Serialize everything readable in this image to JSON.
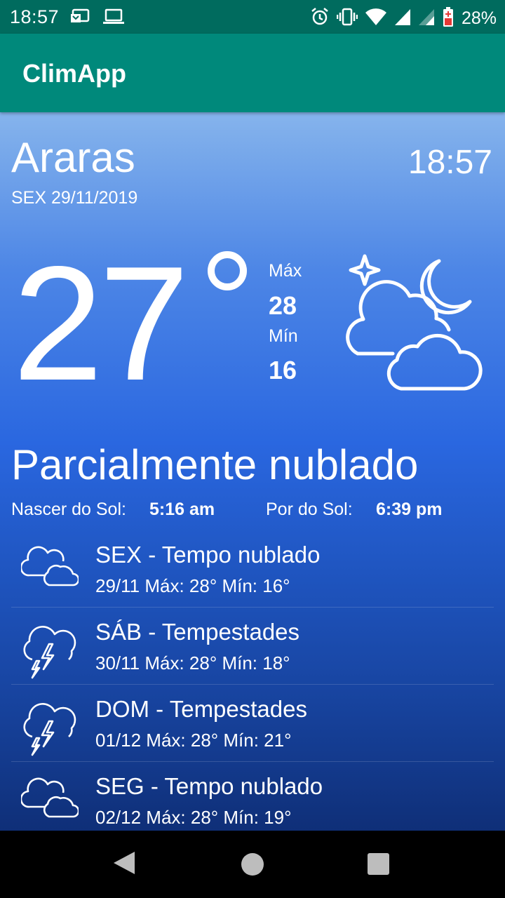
{
  "status_bar": {
    "time": "18:57",
    "battery_percent": "28%",
    "left_icons": [
      "notification-card-icon",
      "laptop-icon"
    ],
    "right_icons": [
      "alarm-icon",
      "vibrate-icon",
      "wifi-icon",
      "signal-icon",
      "signal-weak-icon",
      "battery-icon"
    ]
  },
  "app_bar": {
    "title": "ClimApp"
  },
  "current": {
    "city": "Araras",
    "time": "18:57",
    "date": "SEX 29/11/2019",
    "temperature": "27",
    "max_label": "Máx",
    "max_value": "28",
    "min_label": "Mín",
    "min_value": "16",
    "icon": "partly-cloudy-night-icon",
    "condition": "Parcialmente nublado",
    "sunrise_label": "Nascer do Sol:",
    "sunrise_value": "5:16 am",
    "sunset_label": "Por do Sol:",
    "sunset_value": "6:39 pm"
  },
  "forecast": [
    {
      "title": "SEX - Tempo nublado",
      "detail": "29/11 Máx: 28° Mín: 16°",
      "icon": "cloudy-icon"
    },
    {
      "title": "SÁB - Tempestades",
      "detail": "30/11 Máx: 28° Mín: 18°",
      "icon": "thunderstorm-icon"
    },
    {
      "title": "DOM - Tempestades",
      "detail": "01/12 Máx: 28° Mín: 21°",
      "icon": "thunderstorm-icon"
    },
    {
      "title": "SEG - Tempo nublado",
      "detail": "02/12 Máx: 28° Mín: 19°",
      "icon": "cloudy-icon"
    }
  ],
  "colors": {
    "status_bar": "#006b5e",
    "app_bar": "#00897b",
    "gradient_top": "#86b4ec",
    "gradient_bottom": "#0f2f78"
  }
}
